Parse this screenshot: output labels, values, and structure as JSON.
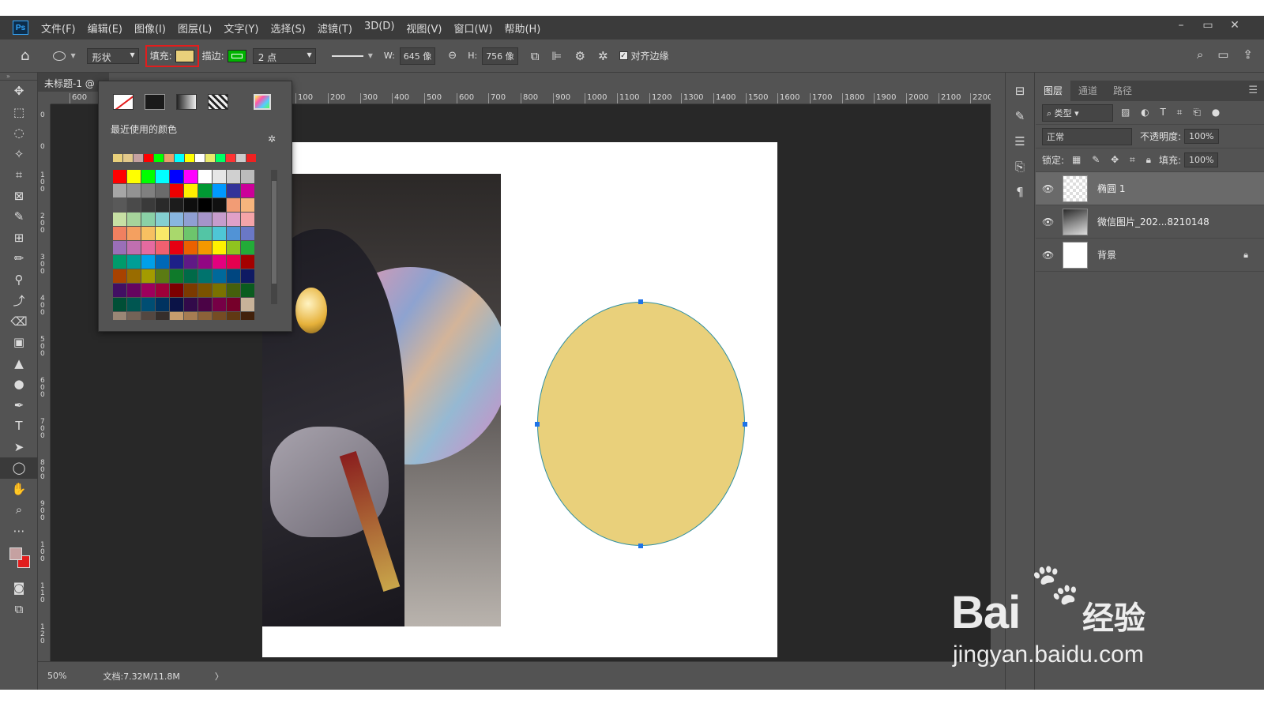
{
  "app": {
    "logo": "Ps",
    "menu": [
      "文件(F)",
      "编辑(E)",
      "图像(I)",
      "图层(L)",
      "文字(Y)",
      "选择(S)",
      "滤镜(T)",
      "3D(D)",
      "视图(V)",
      "窗口(W)",
      "帮助(H)"
    ],
    "window_controls": [
      "–",
      "▭",
      "✕"
    ]
  },
  "options": {
    "mode": "形状",
    "fill_label": "填充:",
    "fill_color": "#e9d07b",
    "stroke_label": "描边:",
    "stroke_color": "#00b300",
    "stroke_width": "2 点",
    "w_label": "W:",
    "w_value": "645 像",
    "h_label": "H:",
    "h_value": "756 像",
    "align_edges": "对齐边缘"
  },
  "document": {
    "tab": "未标题-1 @",
    "ruler_x": [
      "600",
      "100",
      "200",
      "300",
      "400",
      "500",
      "600",
      "700",
      "800",
      "900",
      "1000",
      "1100",
      "1200",
      "1300",
      "1400",
      "1500",
      "1600",
      "1700",
      "1800",
      "1900",
      "2000",
      "2100",
      "2200"
    ],
    "ruler_y": [
      "0",
      "0",
      "1 0 0",
      "2 0 0",
      "3 0 0",
      "4 0 0",
      "5 0 0",
      "6 0 0",
      "7 0 0",
      "8 0 0",
      "9 0 0",
      "1 0 0",
      "1 1 0",
      "1 2 0"
    ],
    "shape_fill": "#e9d07b",
    "shape_stroke": "#2f8fa0"
  },
  "swatch_popup": {
    "recent_label": "最近使用的颜色",
    "recent_colors": [
      "#e9d07b",
      "#e3c98a",
      "#c5a1a1",
      "#ff0000",
      "#00ff00",
      "#e9a06a",
      "#00ffff",
      "#ffff00",
      "#ffffff",
      "#e9e96a",
      "#00ff66",
      "#ff3333",
      "#cccccc",
      "#ee2222"
    ],
    "grid_colors": [
      "#ff0000",
      "#ffff00",
      "#00ff00",
      "#00ffff",
      "#0000ff",
      "#ff00ff",
      "#ffffff",
      "#e6e6e6",
      "#d0d0d0",
      "#bbbbbb",
      "#a6a6a6",
      "#939393",
      "#808080",
      "#6b6b6b",
      "#ee0000",
      "#ffee00",
      "#009933",
      "#0099ff",
      "#333399",
      "#cc0099",
      "#595959",
      "#4a4a4a",
      "#3a3a3a",
      "#2a2a2a",
      "#1c1c1c",
      "#0e0e0e",
      "#000000",
      "#111111",
      "#f29c75",
      "#f6b57d",
      "#c7e0a4",
      "#a6d49b",
      "#8ad0a6",
      "#84cfd1",
      "#88b6e0",
      "#8f9fd3",
      "#a594c9",
      "#c79ccc",
      "#e0a0c8",
      "#f4a4a8",
      "#f08060",
      "#f4a060",
      "#f7c061",
      "#f9e968",
      "#a9d86c",
      "#6dc56c",
      "#53c5a5",
      "#4ec6d6",
      "#5193d6",
      "#6a78c6",
      "#9a6fb8",
      "#c06fb0",
      "#e56aa0",
      "#f06070",
      "#e60012",
      "#eb6100",
      "#f39800",
      "#fff100",
      "#8fc31f",
      "#22ac38",
      "#009b6b",
      "#009e96",
      "#00a0e9",
      "#0068b7",
      "#1d2088",
      "#601986",
      "#920783",
      "#e4007f",
      "#e5004f",
      "#a40000",
      "#a84200",
      "#996c00",
      "#a39b00",
      "#5b7b13",
      "#0f7a2a",
      "#006a48",
      "#00736d",
      "#00699b",
      "#004680",
      "#0f1a63",
      "#420f63",
      "#65045f",
      "#9e005d",
      "#9e0039",
      "#7d0000",
      "#7b3a00",
      "#7a5300",
      "#7a7200",
      "#45600c",
      "#0a5c1f",
      "#004f36",
      "#005651",
      "#004e73",
      "#003360",
      "#0b1347",
      "#320a4a",
      "#4b0346",
      "#760046",
      "#76002a",
      "#c7b299",
      "#998675",
      "#736357",
      "#534741",
      "#362e2b",
      "#c69c6d",
      "#a67c52",
      "#8c6239",
      "#754c24",
      "#603913",
      "#42210b"
    ]
  },
  "layers": {
    "tabs": [
      "图层",
      "通道",
      "路径"
    ],
    "filter_kind": "类型",
    "blend_mode": "正常",
    "opacity_label": "不透明度:",
    "opacity": "100%",
    "lock_label": "锁定:",
    "fill_label": "填充:",
    "fill": "100%",
    "items": [
      {
        "name": "椭圆 1"
      },
      {
        "name": "微信图片_202...8210148"
      },
      {
        "name": "背景"
      }
    ]
  },
  "status": {
    "zoom": "50%",
    "doc_size": "文档:7.32M/11.8M",
    "arrow": "〉"
  },
  "watermark": {
    "brand": "Bai",
    "brand_cn": "经验",
    "url": "jingyan.baidu.com"
  }
}
